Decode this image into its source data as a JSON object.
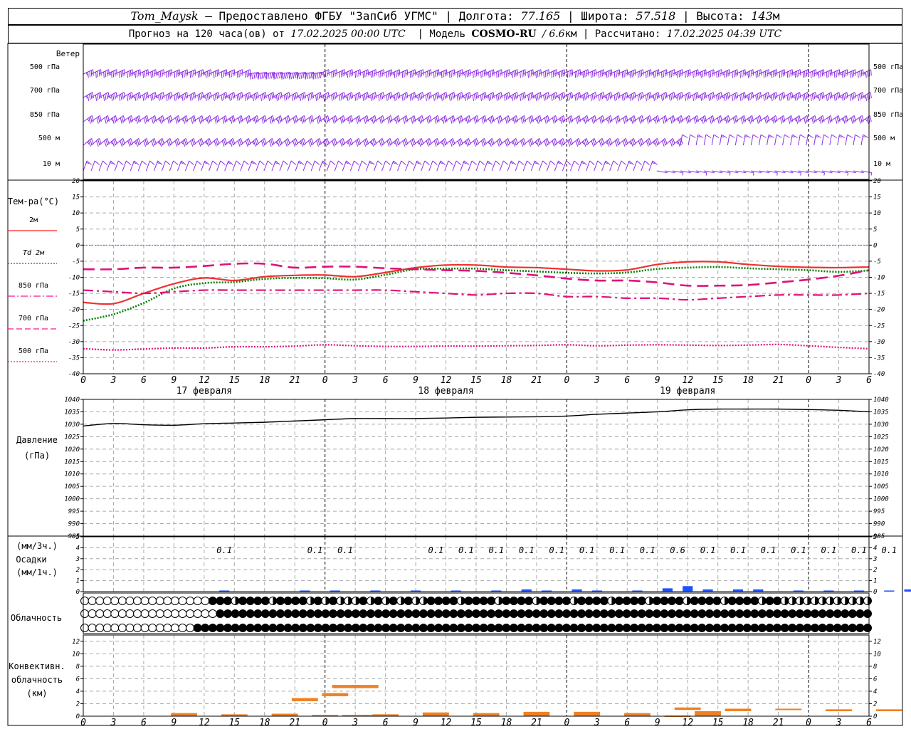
{
  "header": {
    "station": "Tom_Maysk",
    "provided_by": "– Предоставлено ФГБУ \"ЗапСиб УГМС\"",
    "lon_label": "Долгота:",
    "lon": "77.165",
    "lat_label": "Широта:",
    "lat": "57.518",
    "alt_label": "Высота:",
    "alt": "143",
    "alt_unit": "м",
    "forecast_label": "Прогноз на 120 часа(ов) от",
    "forecast_start": "17.02.2025 00:00 UTC",
    "model_label": "Модель",
    "model": "COSMO-RU",
    "resolution": "/ 6.6",
    "resolution_unit": "км",
    "computed_label": "Рассчитано:",
    "computed_at": "17.02.2025 04:39 UTC"
  },
  "wind_panel": {
    "title": "Ветер",
    "levels": [
      "500 гПа",
      "700 гПа",
      "850 гПа",
      "500 м",
      "10  м"
    ],
    "barb_color": "#8a2be2"
  },
  "temp_panel": {
    "title": "Тем-ра(°C)",
    "legend": [
      {
        "label": "2м",
        "color": "#ff2020",
        "style": "solid"
      },
      {
        "label": "Td  2м",
        "color": "#008000",
        "style": "dotted"
      },
      {
        "label": "850 гПа",
        "color": "#ff1493",
        "style": "dashdot"
      },
      {
        "label": "700 гПа",
        "color": "#ff1493",
        "style": "dashed"
      },
      {
        "label": "500 гПа",
        "color": "#ff1493",
        "style": "dotted"
      }
    ]
  },
  "hour_ticks": [
    "0",
    "3",
    "6",
    "9",
    "12",
    "15",
    "18",
    "21",
    "0",
    "3",
    "6",
    "9",
    "12",
    "15",
    "18",
    "21",
    "0",
    "3",
    "6",
    "9",
    "12",
    "15",
    "18",
    "21",
    "0",
    "3",
    "6"
  ],
  "days": [
    "17 февраля",
    "18 февраля",
    "19 февраля"
  ],
  "pressure_panel": {
    "title": "Давление",
    "unit": "(гПа)"
  },
  "precip_panel": {
    "unit_top": "(мм/3ч.)",
    "title": "Осадки",
    "unit_bottom": "(мм/1ч.)",
    "totals": [
      {
        "h": 14,
        "v": "0.1"
      },
      {
        "h": 23,
        "v": "0.1"
      },
      {
        "h": 26,
        "v": "0.1"
      },
      {
        "h": 35,
        "v": "0.1"
      },
      {
        "h": 38,
        "v": "0.1"
      },
      {
        "h": 41,
        "v": "0.1"
      },
      {
        "h": 44,
        "v": "0.1"
      },
      {
        "h": 47,
        "v": "0.1"
      },
      {
        "h": 50,
        "v": "0.1"
      },
      {
        "h": 53,
        "v": "0.1"
      },
      {
        "h": 56,
        "v": "0.1"
      },
      {
        "h": 59,
        "v": "0.6"
      },
      {
        "h": 62,
        "v": "0.1"
      },
      {
        "h": 65,
        "v": "0.1"
      },
      {
        "h": 68,
        "v": "0.1"
      },
      {
        "h": 71,
        "v": "0.1"
      },
      {
        "h": 74,
        "v": "0.1"
      },
      {
        "h": 77,
        "v": "0.1"
      },
      {
        "h": 80,
        "v": "0.1"
      },
      {
        "h": 83,
        "v": "0.1"
      }
    ]
  },
  "cloud_panel": {
    "title": "Облачность"
  },
  "conv_panel": {
    "title_1": "Конвективн.",
    "title_2": "облачность",
    "unit": "(км)"
  },
  "chart_data": [
    {
      "type": "line",
      "title": "Тем-ра(°C)",
      "x_unit": "hours from 17.02.2025 00:00 UTC",
      "ylim": [
        -40,
        20
      ],
      "yticks": [
        -40,
        -35,
        -30,
        -25,
        -20,
        -15,
        -10,
        -5,
        0,
        5,
        10,
        15,
        20
      ],
      "grid": true,
      "series": [
        {
          "name": "2м",
          "x": [
            0,
            3,
            6,
            9,
            12,
            15,
            18,
            21,
            24,
            27,
            30,
            33,
            36,
            39,
            42,
            45,
            48,
            51,
            54,
            57,
            60,
            63,
            66,
            69,
            72,
            75,
            78
          ],
          "values": [
            -17.8,
            -18.2,
            -15,
            -12,
            -10.2,
            -11,
            -9.8,
            -9.4,
            -9.3,
            -9.8,
            -8.5,
            -7,
            -6.2,
            -6.2,
            -6.8,
            -7,
            -7.5,
            -8,
            -7.7,
            -6,
            -5.2,
            -5.2,
            -6,
            -6.6,
            -6.9,
            -7,
            -6.8
          ]
        },
        {
          "name": "Td  2м",
          "x": [
            0,
            3,
            6,
            9,
            12,
            15,
            18,
            21,
            24,
            27,
            30,
            33,
            36,
            39,
            42,
            45,
            48,
            51,
            54,
            57,
            60,
            63,
            66,
            69,
            72,
            75,
            78
          ],
          "values": [
            -23.5,
            -21.5,
            -18,
            -13.5,
            -11.8,
            -11.5,
            -10.5,
            -10.2,
            -10.3,
            -10.7,
            -9.2,
            -7.5,
            -7.3,
            -7.3,
            -7.8,
            -8.2,
            -8.6,
            -8.8,
            -8.5,
            -7.4,
            -7,
            -6.8,
            -7.2,
            -7.5,
            -7.8,
            -8.3,
            -7.9
          ]
        },
        {
          "name": "850 гПа",
          "x": [
            0,
            3,
            6,
            9,
            12,
            15,
            18,
            21,
            24,
            27,
            30,
            33,
            36,
            39,
            42,
            45,
            48,
            51,
            54,
            57,
            60,
            63,
            66,
            69,
            72,
            75,
            78
          ],
          "values": [
            -14,
            -14.5,
            -15,
            -14.5,
            -14,
            -14,
            -14,
            -14,
            -14,
            -14,
            -14,
            -14.5,
            -15,
            -15.5,
            -15,
            -15,
            -16,
            -16,
            -16.5,
            -16.5,
            -17,
            -16.5,
            -16,
            -15.5,
            -15.5,
            -15.5,
            -15
          ]
        },
        {
          "name": "700 гПа",
          "x": [
            0,
            3,
            6,
            9,
            12,
            15,
            18,
            21,
            24,
            27,
            30,
            33,
            36,
            39,
            42,
            45,
            48,
            51,
            54,
            57,
            60,
            63,
            66,
            69,
            72,
            75,
            78
          ],
          "values": [
            -7.5,
            -7.5,
            -7,
            -7,
            -6.5,
            -5.8,
            -5.8,
            -7,
            -6.7,
            -6.7,
            -7.2,
            -7.5,
            -7.8,
            -8,
            -8.6,
            -9.4,
            -10.4,
            -11,
            -11,
            -11.6,
            -12.6,
            -12.6,
            -12.4,
            -11.6,
            -10.7,
            -9.5,
            -7.8
          ]
        },
        {
          "name": "500 гПа",
          "x": [
            0,
            3,
            6,
            9,
            12,
            15,
            18,
            21,
            24,
            27,
            30,
            33,
            36,
            39,
            42,
            45,
            48,
            51,
            54,
            57,
            60,
            63,
            66,
            69,
            72,
            75,
            78
          ],
          "values": [
            -32.2,
            -32.6,
            -32.3,
            -32,
            -32,
            -31.6,
            -31.6,
            -31.4,
            -31,
            -31.3,
            -31.5,
            -31.5,
            -31.4,
            -31.4,
            -31.3,
            -31.2,
            -31,
            -31.3,
            -31.1,
            -31,
            -31.1,
            -31.2,
            -31.1,
            -30.9,
            -31.3,
            -31.8,
            -32.2
          ]
        }
      ]
    },
    {
      "type": "line",
      "title": "Давление (гПа)",
      "ylim": [
        985,
        1040
      ],
      "yticks": [
        985,
        990,
        995,
        1000,
        1005,
        1010,
        1015,
        1020,
        1025,
        1030,
        1035,
        1040
      ],
      "grid": true,
      "series": [
        {
          "name": "Давление",
          "x": [
            0,
            3,
            6,
            9,
            12,
            15,
            18,
            21,
            24,
            27,
            30,
            33,
            36,
            39,
            42,
            45,
            48,
            51,
            54,
            57,
            60,
            63,
            66,
            69,
            72,
            75,
            78
          ],
          "values": [
            1029.3,
            1030.3,
            1029.8,
            1029.6,
            1030.2,
            1030.5,
            1030.8,
            1031.3,
            1031.8,
            1032.3,
            1032.3,
            1032.3,
            1032.5,
            1032.8,
            1032.9,
            1033,
            1033.3,
            1034,
            1034.5,
            1035,
            1035.8,
            1036.1,
            1036.1,
            1036.1,
            1035.9,
            1035.6,
            1035
          ]
        }
      ]
    },
    {
      "type": "bar",
      "title": "Осадки (мм/1ч.)",
      "ylim": [
        0,
        5
      ],
      "yticks": [
        0,
        1,
        2,
        3,
        4,
        5
      ],
      "series": [
        {
          "name": "Осадки",
          "x": [
            14,
            22,
            25,
            29,
            33,
            37,
            41,
            44,
            46,
            49,
            51,
            55,
            58,
            60,
            62,
            65,
            67,
            71,
            74,
            77,
            80,
            82,
            84
          ],
          "values": [
            0.1,
            0.1,
            0.1,
            0.1,
            0.1,
            0.1,
            0.1,
            0.2,
            0.1,
            0.2,
            0.1,
            0.1,
            0.3,
            0.5,
            0.2,
            0.2,
            0.2,
            0.1,
            0.1,
            0.1,
            0.1,
            0.2,
            0.2
          ]
        }
      ]
    },
    {
      "type": "bar",
      "title": "Конвективн. облачность (км)",
      "ylim": [
        0,
        13
      ],
      "yticks": [
        0,
        2,
        4,
        6,
        8,
        10,
        12
      ],
      "series": [
        {
          "name": "bottom",
          "x": [
            10,
            15,
            20,
            22,
            24,
            25,
            26,
            27,
            28,
            29,
            30,
            35,
            40,
            45,
            50,
            55,
            59,
            60,
            62,
            65,
            70,
            75,
            80
          ],
          "values": [
            0,
            0,
            0,
            2.4,
            0,
            3.2,
            4.5,
            0,
            4.5,
            0,
            0,
            0,
            0,
            0,
            0,
            0,
            0,
            1,
            0,
            0.8,
            1,
            0.8,
            0.8
          ]
        },
        {
          "name": "top",
          "x": [
            10,
            15,
            20,
            22,
            24,
            25,
            26,
            27,
            28,
            29,
            30,
            35,
            40,
            45,
            50,
            55,
            59,
            60,
            62,
            65,
            70,
            75,
            80
          ],
          "values": [
            0.5,
            0.3,
            0.4,
            2.9,
            0.2,
            3.7,
            5,
            0.2,
            5,
            0.2,
            0.3,
            0.6,
            0.5,
            0.7,
            0.7,
            0.5,
            0.1,
            1.4,
            0.8,
            1.2,
            1.2,
            1.1,
            1.1
          ]
        }
      ]
    }
  ]
}
